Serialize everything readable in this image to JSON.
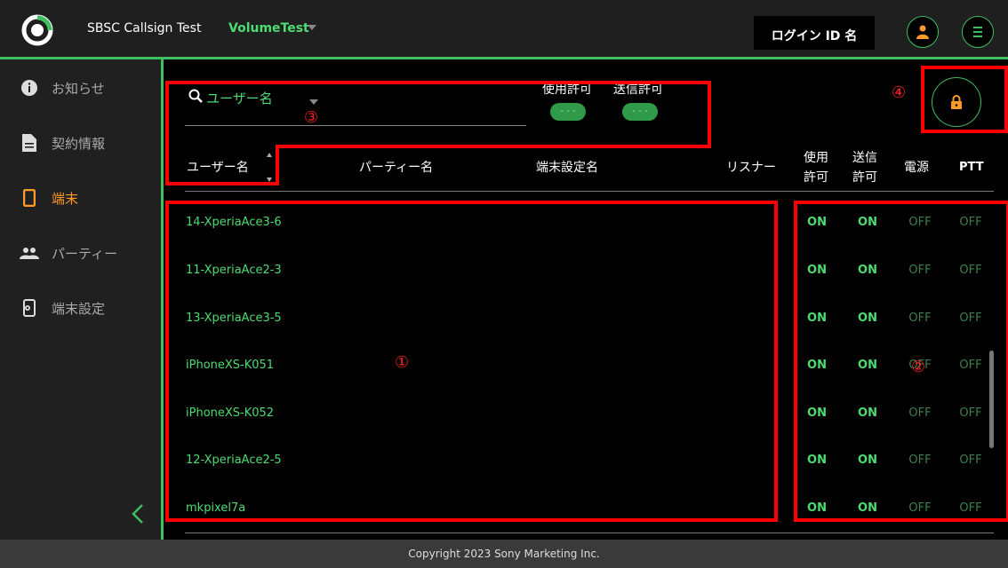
{
  "header": {
    "app_title": "SBSC Callsign Test",
    "app_subtitle": "VolumeTest",
    "login_label": "ログイン ID 名",
    "accent_color": "#3fbf5f"
  },
  "sidebar": {
    "items": [
      {
        "label": "お知らせ",
        "icon": "info-icon"
      },
      {
        "label": "契約情報",
        "icon": "document-icon"
      },
      {
        "label": "端末",
        "icon": "phone-icon"
      },
      {
        "label": "パーティー",
        "icon": "group-icon"
      },
      {
        "label": "端末設定",
        "icon": "device-settings-icon"
      }
    ],
    "active_index": 2
  },
  "filters": {
    "search_value": "ユーザー名",
    "use_permission_label": "使用許可",
    "send_permission_label": "送信許可",
    "toggle_text": "- - -"
  },
  "table": {
    "columns": [
      "ユーザー名",
      "パーティー名",
      "端末設定名",
      "リスナー",
      "使用\n許可",
      "送信\n許可",
      "電源",
      "PTT"
    ],
    "col_user": "ユーザー名",
    "col_party": "パーティー名",
    "col_terminal": "端末設定名",
    "col_listener": "リスナー",
    "col_use_1": "使用",
    "col_use_2": "許可",
    "col_send_1": "送信",
    "col_send_2": "許可",
    "col_power": "電源",
    "col_ptt": "PTT",
    "rows": [
      {
        "name": "14-XperiaAce3-6",
        "use": "ON",
        "send": "ON",
        "power": "OFF",
        "ptt": "OFF"
      },
      {
        "name": "11-XperiaAce2-3",
        "use": "ON",
        "send": "ON",
        "power": "OFF",
        "ptt": "OFF"
      },
      {
        "name": "13-XperiaAce3-5",
        "use": "ON",
        "send": "ON",
        "power": "OFF",
        "ptt": "OFF"
      },
      {
        "name": "iPhoneXS-K051",
        "use": "ON",
        "send": "ON",
        "power": "OFF",
        "ptt": "OFF"
      },
      {
        "name": "iPhoneXS-K052",
        "use": "ON",
        "send": "ON",
        "power": "OFF",
        "ptt": "OFF"
      },
      {
        "name": "12-XperiaAce2-5",
        "use": "ON",
        "send": "ON",
        "power": "OFF",
        "ptt": "OFF"
      },
      {
        "name": "mkpixel7a",
        "use": "ON",
        "send": "ON",
        "power": "OFF",
        "ptt": "OFF"
      }
    ]
  },
  "annotations": {
    "n1": "①",
    "n2": "②",
    "n3": "③",
    "n4": "④",
    "color": "#ff0000"
  },
  "footer": {
    "copyright": "Copyright 2023 Sony Marketing Inc."
  }
}
